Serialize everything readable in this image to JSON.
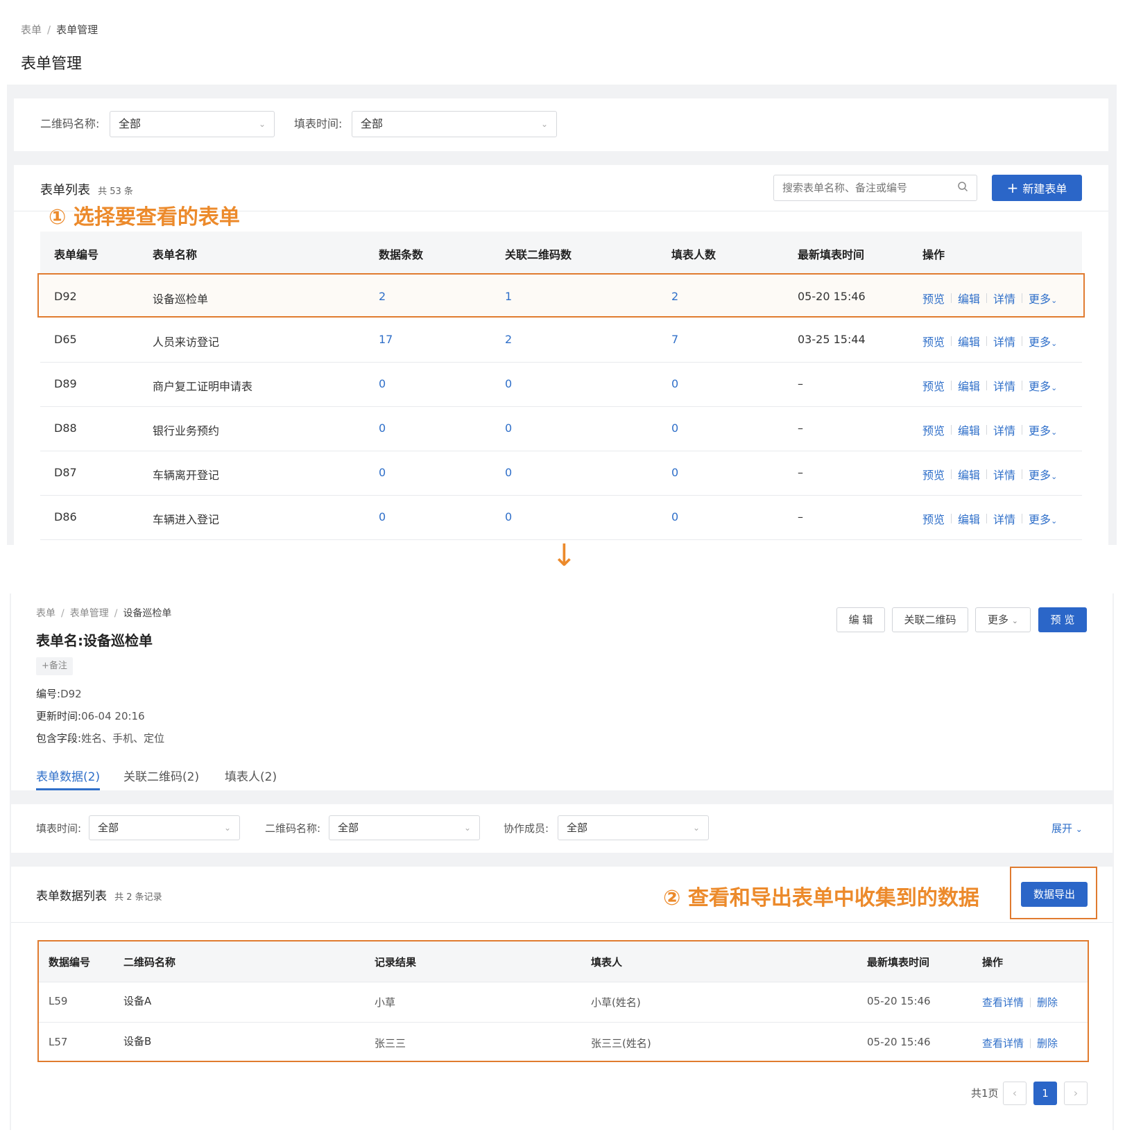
{
  "top": {
    "breadcrumb": [
      "表单",
      "表单管理"
    ],
    "page_title": "表单管理",
    "filters": {
      "qr_label": "二维码名称:",
      "qr_value": "全部",
      "time_label": "填表时间:",
      "time_value": "全部"
    },
    "list_title": "表单列表",
    "list_count": "共 53 条",
    "search_placeholder": "搜索表单名称、备注或编号",
    "new_button": "新建表单",
    "annotation": "① 选择要查看的表单",
    "headers": [
      "表单编号",
      "表单名称",
      "数据条数",
      "关联二维码数",
      "填表人数",
      "最新填表时间",
      "操作"
    ],
    "rows": [
      {
        "id": "D92",
        "name": "设备巡检单",
        "data": "2",
        "qr": "1",
        "people": "2",
        "time": "05-20 15:46"
      },
      {
        "id": "D65",
        "name": "人员来访登记",
        "data": "17",
        "qr": "2",
        "people": "7",
        "time": "03-25 15:44"
      },
      {
        "id": "D89",
        "name": "商户复工证明申请表",
        "data": "0",
        "qr": "0",
        "people": "0",
        "time": "–"
      },
      {
        "id": "D88",
        "name": "银行业务预约",
        "data": "0",
        "qr": "0",
        "people": "0",
        "time": "–"
      },
      {
        "id": "D87",
        "name": "车辆离开登记",
        "data": "0",
        "qr": "0",
        "people": "0",
        "time": "–"
      },
      {
        "id": "D86",
        "name": "车辆进入登记",
        "data": "0",
        "qr": "0",
        "people": "0",
        "time": "–"
      }
    ],
    "row_ops": [
      "预览",
      "编辑",
      "详情",
      "更多"
    ]
  },
  "arrow": "↓",
  "detail": {
    "breadcrumb": [
      "表单",
      "表单管理",
      "设备巡检单"
    ],
    "title": "表单名:设备巡检单",
    "add_note": "+备注",
    "buttons": {
      "edit": "编 辑",
      "qr": "关联二维码",
      "more": "更多",
      "preview": "预 览"
    },
    "meta": [
      {
        "label": "编号:",
        "value": "D92"
      },
      {
        "label": "更新时间:",
        "value": "06-04 20:16"
      },
      {
        "label": "包含字段:",
        "value": "姓名、手机、定位"
      }
    ],
    "tabs": [
      "表单数据(2)",
      "关联二维码(2)",
      "填表人(2)"
    ],
    "filters": {
      "time_label": "填表时间:",
      "time_value": "全部",
      "qr_label": "二维码名称:",
      "qr_value": "全部",
      "member_label": "协作成员:",
      "member_value": "全部",
      "expand": "展开"
    },
    "list_title": "表单数据列表",
    "list_count": "共 2 条记录",
    "annotation": "② 查看和导出表单中收集到的数据",
    "export_button": "数据导出",
    "headers": [
      "数据编号",
      "二维码名称",
      "记录结果",
      "填表人",
      "最新填表时间",
      "操作"
    ],
    "rows": [
      {
        "id": "L59",
        "qr": "设备A",
        "result": "小草",
        "filler": "小草(姓名)",
        "time": "05-20 15:46"
      },
      {
        "id": "L57",
        "qr": "设备B",
        "result": "张三三",
        "filler": "张三三(姓名)",
        "time": "05-20 15:46"
      }
    ],
    "row_ops": [
      "查看详情",
      "删除"
    ],
    "pagination": {
      "total": "共1页",
      "prev": "‹",
      "page": "1",
      "next": "›"
    }
  },
  "colors": {
    "accent": "#2b66c8",
    "link": "#2f6fc9",
    "annotation": "#ec8a2b",
    "highlight_border": "#e07b2f"
  }
}
